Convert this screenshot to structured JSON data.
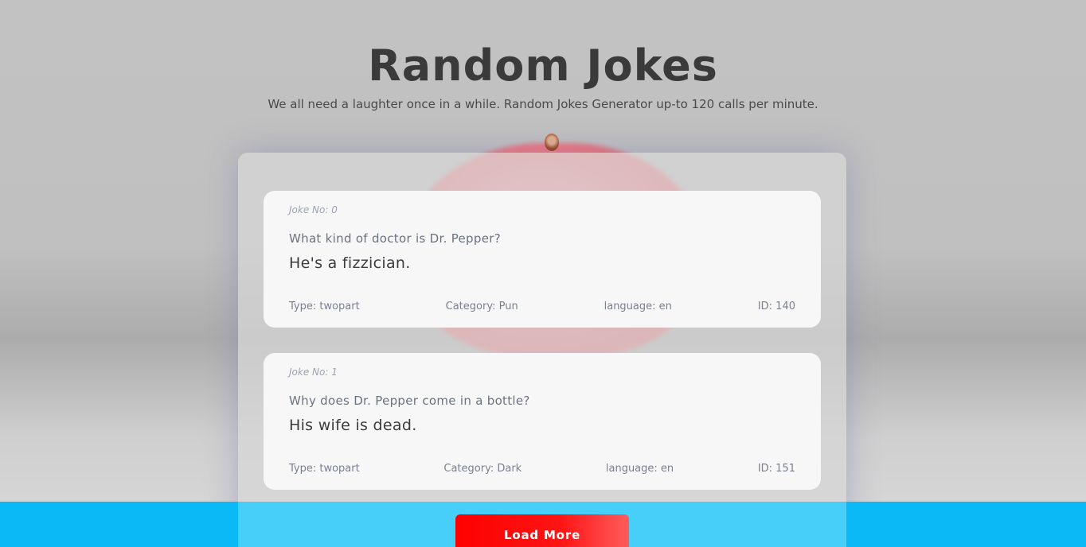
{
  "header": {
    "title": "Random Jokes",
    "subtitle": "We all need a laughter once in a while. Random Jokes Generator up-to 120 calls per minute."
  },
  "jokes": [
    {
      "number_label": "Joke No: 0",
      "setup": "What kind of doctor is Dr. Pepper?",
      "delivery": "He's a fizzician.",
      "type_label": "Type: twopart",
      "category_label": "Category: Pun",
      "language_label": "language: en",
      "id_label": "ID: 140"
    },
    {
      "number_label": "Joke No: 1",
      "setup": "Why does Dr. Pepper come in a bottle?",
      "delivery": "His wife is dead.",
      "type_label": "Type: twopart",
      "category_label": "Category: Dark",
      "language_label": "language: en",
      "id_label": "ID: 151"
    }
  ],
  "actions": {
    "load_more_label": "Load More"
  },
  "colors": {
    "accent_button": "#ff0000",
    "footer_bar": "#0ab9f6",
    "title_text": "#3a3a3a"
  },
  "icons": {
    "background": "apple-background-image"
  }
}
